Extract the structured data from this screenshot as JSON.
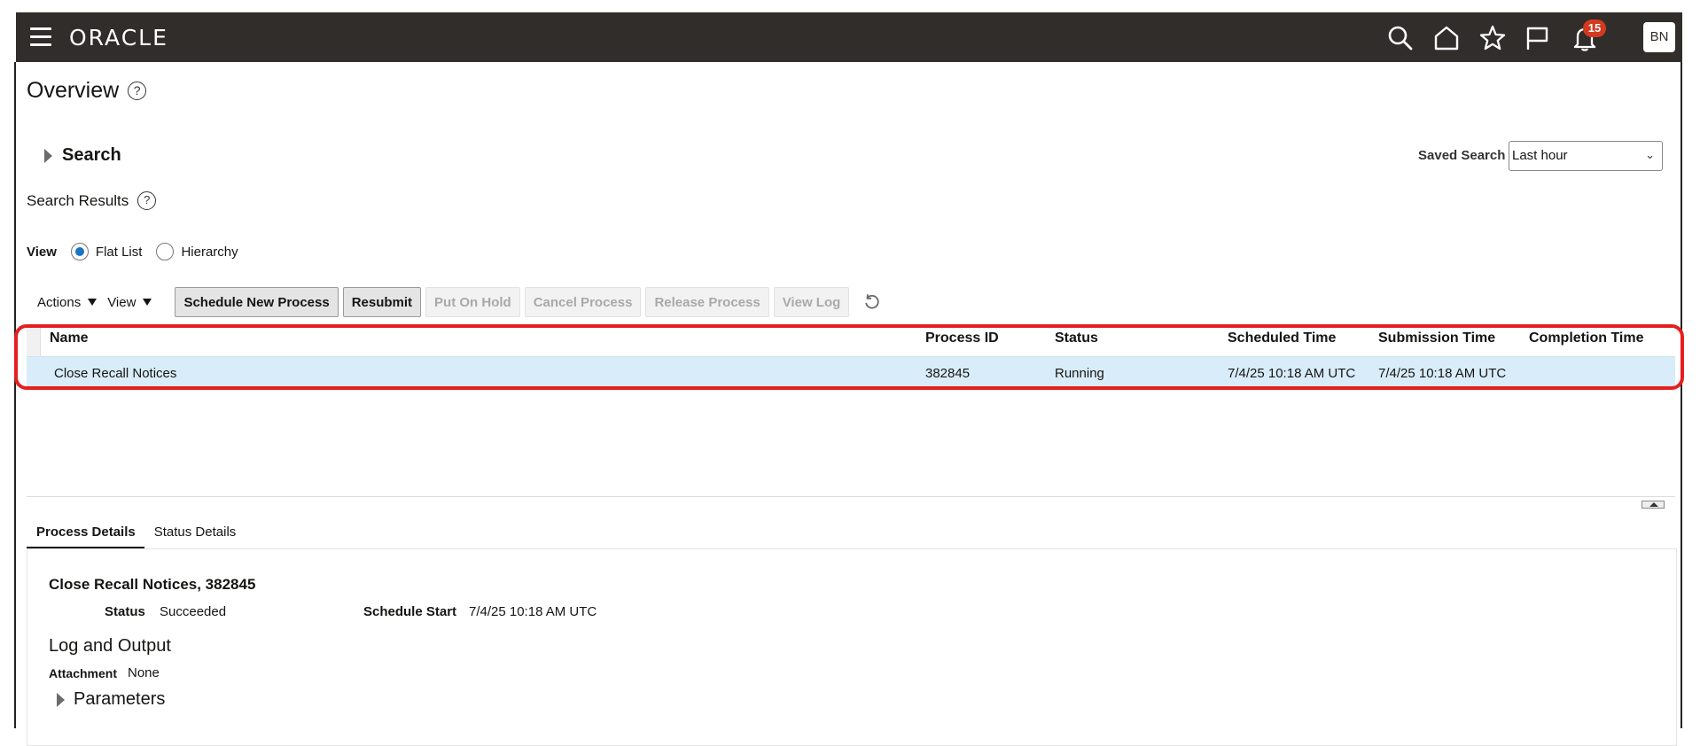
{
  "header": {
    "logo": "ORACLE",
    "notification_count": "15",
    "user_initials": "BN"
  },
  "page": {
    "title": "Overview",
    "help_glyph": "?"
  },
  "search": {
    "label": "Search",
    "saved_search_label": "Saved Search",
    "saved_search_value": "Last hour"
  },
  "results": {
    "title": "Search Results",
    "view_label": "View",
    "view_options": [
      "Flat List",
      "Hierarchy"
    ],
    "selected_view": "Flat List"
  },
  "toolbar": {
    "actions_menu": "Actions",
    "view_menu": "View",
    "buttons": {
      "schedule": "Schedule New Process",
      "resubmit": "Resubmit",
      "put_on_hold": "Put On Hold",
      "cancel": "Cancel Process",
      "release": "Release Process",
      "view_log": "View Log"
    }
  },
  "table": {
    "columns": [
      "Name",
      "Process ID",
      "Status",
      "Scheduled Time",
      "Submission Time",
      "Completion Time"
    ],
    "rows": [
      {
        "name": "Close Recall Notices",
        "process_id": "382845",
        "status": "Running",
        "scheduled_time": "7/4/25 10:18 AM UTC",
        "submission_time": "7/4/25 10:18 AM UTC",
        "completion_time": ""
      }
    ]
  },
  "details": {
    "tabs": [
      "Process Details",
      "Status Details"
    ],
    "active_tab": "Process Details",
    "title": "Close Recall Notices, 382845",
    "status_label": "Status",
    "status_value": "Succeeded",
    "schedule_start_label": "Schedule Start",
    "schedule_start_value": "7/4/25 10:18 AM UTC",
    "log_section_title": "Log and Output",
    "attachment_label": "Attachment",
    "attachment_value": "None",
    "parameters_label": "Parameters"
  },
  "colors": {
    "header_bg": "#312d2a",
    "selected_row_bg": "#d9ecf9",
    "highlight_border": "#e41f1f",
    "badge_bg": "#d33a1f",
    "radio_accent": "#1a73c4"
  },
  "icons": [
    "hamburger-icon",
    "search-icon",
    "home-icon",
    "star-icon",
    "flag-icon",
    "bell-icon",
    "help-icon",
    "chevron-down-icon",
    "refresh-icon",
    "triangle-right-icon",
    "collapse-icon"
  ]
}
